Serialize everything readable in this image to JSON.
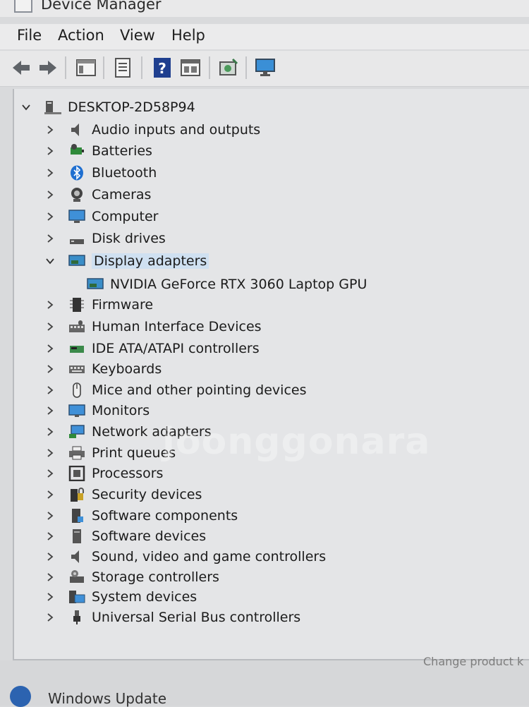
{
  "window": {
    "title": "Device Manager"
  },
  "menu": {
    "file": "File",
    "action": "Action",
    "view": "View",
    "help": "Help"
  },
  "toolbar": {
    "buttons": [
      "back-icon",
      "forward-icon",
      "console-tree-icon",
      "properties-icon",
      "help-icon",
      "view-icon",
      "scan-hardware-icon",
      "monitor-icon"
    ]
  },
  "tree": {
    "root": "DESKTOP-2D58P94",
    "categories": [
      {
        "label": "Audio inputs and outputs",
        "icon": "speaker-icon"
      },
      {
        "label": "Batteries",
        "icon": "battery-icon"
      },
      {
        "label": "Bluetooth",
        "icon": "bluetooth-icon"
      },
      {
        "label": "Cameras",
        "icon": "camera-icon"
      },
      {
        "label": "Computer",
        "icon": "computer-icon"
      },
      {
        "label": "Disk drives",
        "icon": "disk-icon"
      },
      {
        "label": "Display adapters",
        "icon": "display-adapter-icon",
        "expanded": true,
        "child": "NVIDIA GeForce RTX 3060 Laptop GPU"
      },
      {
        "label": "Firmware",
        "icon": "firmware-icon"
      },
      {
        "label": "Human Interface Devices",
        "icon": "hid-icon"
      },
      {
        "label": "IDE ATA/ATAPI controllers",
        "icon": "ide-icon"
      },
      {
        "label": "Keyboards",
        "icon": "keyboard-icon"
      },
      {
        "label": "Mice and other pointing devices",
        "icon": "mouse-icon"
      },
      {
        "label": "Monitors",
        "icon": "monitor-icon"
      },
      {
        "label": "Network adapters",
        "icon": "network-icon"
      },
      {
        "label": "Print queues",
        "icon": "printer-icon"
      },
      {
        "label": "Processors",
        "icon": "processor-icon"
      },
      {
        "label": "Security devices",
        "icon": "security-icon"
      },
      {
        "label": "Software components",
        "icon": "software-component-icon"
      },
      {
        "label": "Software devices",
        "icon": "software-device-icon"
      },
      {
        "label": "Sound, video and game controllers",
        "icon": "sound-icon"
      },
      {
        "label": "Storage controllers",
        "icon": "storage-icon"
      },
      {
        "label": "System devices",
        "icon": "system-icon"
      },
      {
        "label": "Universal Serial Bus controllers",
        "icon": "usb-icon"
      }
    ]
  },
  "background": {
    "windows_update": "Windows Update",
    "partial_text": "Change product k"
  },
  "watermark": "joonggonara"
}
